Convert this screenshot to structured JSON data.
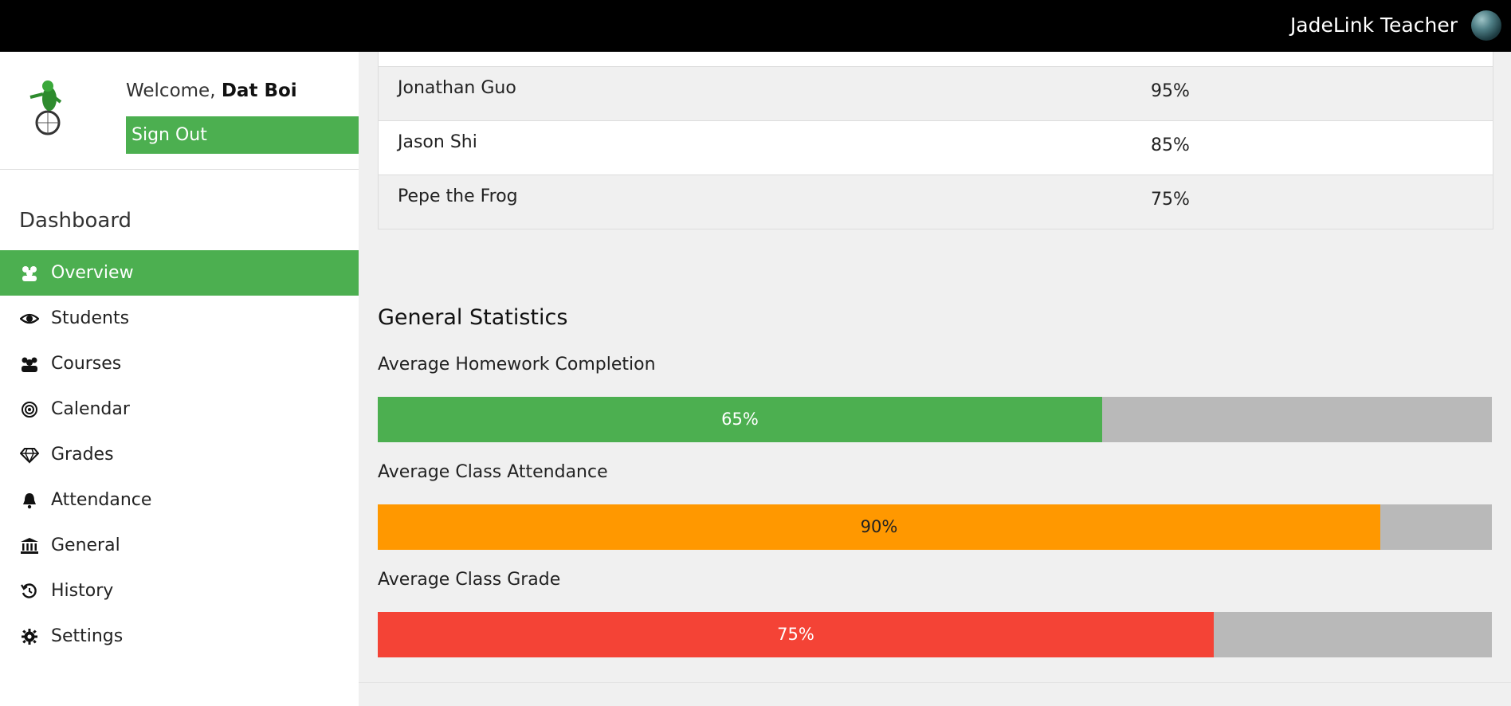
{
  "header": {
    "brand": "JadeLink Teacher"
  },
  "profile": {
    "welcome_prefix": "Welcome, ",
    "user_name": "Dat Boi",
    "sign_out": "Sign Out"
  },
  "sidebar": {
    "title": "Dashboard",
    "items": [
      {
        "label": "Overview",
        "icon": "users-icon",
        "active": true
      },
      {
        "label": "Students",
        "icon": "eye-icon"
      },
      {
        "label": "Courses",
        "icon": "group-icon"
      },
      {
        "label": "Calendar",
        "icon": "target-icon"
      },
      {
        "label": "Grades",
        "icon": "diamond-icon"
      },
      {
        "label": "Attendance",
        "icon": "bell-icon"
      },
      {
        "label": "General",
        "icon": "bank-icon"
      },
      {
        "label": "History",
        "icon": "history-icon"
      },
      {
        "label": "Settings",
        "icon": "gear-icon"
      }
    ]
  },
  "students_table": {
    "rows": [
      {
        "name": "Jonathan Guo",
        "percent": "95%"
      },
      {
        "name": "Jason Shi",
        "percent": "85%"
      },
      {
        "name": "Pepe the Frog",
        "percent": "75%"
      }
    ]
  },
  "stats": {
    "title": "General Statistics",
    "bars": [
      {
        "label": "Average Homework Completion",
        "text": "65%",
        "fraction": 0.65,
        "color": "#4caf50",
        "text_color": "#ffffff"
      },
      {
        "label": "Average Class Attendance",
        "text": "90%",
        "fraction": 0.9,
        "color": "#ff9800",
        "text_color": "#222222"
      },
      {
        "label": "Average Class Grade",
        "text": "75%",
        "fraction": 0.75,
        "color": "#f44336",
        "text_color": "#ffffff"
      }
    ]
  }
}
